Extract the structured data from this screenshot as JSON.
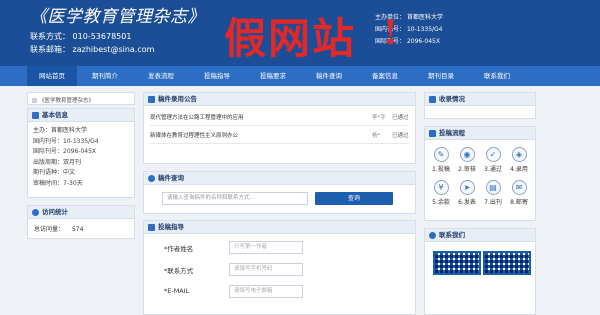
{
  "header": {
    "title": "《医学教育管理杂志》",
    "phone_label": "联系方式：",
    "phone": "010-53678501",
    "email_label": "联系邮箱：",
    "email": "zazhibest@sina.com",
    "sponsor_label": "主办单位：",
    "sponsor": "首都医科大学",
    "cn_label": "国内刊号：",
    "cn": "10-1335/G4",
    "issn_label": "国际刊号：",
    "issn": "2096-045X",
    "overlay_text": "假网站",
    "overlay_mark": "!"
  },
  "nav": [
    "网站首页",
    "期刊简介",
    "发表流程",
    "投稿指导",
    "投稿要求",
    "稿件查询",
    "备案信息",
    "期刊目录",
    "联系我们"
  ],
  "left": {
    "logo_alt": "《医学教育管理杂志》",
    "basic_title": "基本信息",
    "basic": [
      {
        "k": "主办：",
        "v": "首都医科大学"
      },
      {
        "k": "国内刊号：",
        "v": "10-1335/G4"
      },
      {
        "k": "国际刊号：",
        "v": "2096-045X"
      },
      {
        "k": "出版周期：",
        "v": "双月刊"
      },
      {
        "k": "期刊语种：",
        "v": "中文"
      },
      {
        "k": "审稿时间：",
        "v": "7-30天"
      }
    ],
    "stats_title": "访问统计",
    "visits_label": "总访问量：",
    "visits": "574"
  },
  "middle": {
    "notice_title": "稿件录用公告",
    "notices": [
      {
        "title": "现代管理方法在公路工程管理中的应用",
        "author": "李*字",
        "status": "已通过"
      },
      {
        "title": "新媒体在教育过程理性主义原则办公",
        "author": "杨*",
        "status": "已通过"
      }
    ],
    "query_title": "稿件查询",
    "query_placeholder": "请输入查询稿件的名称和联系方式...",
    "query_button": "查询",
    "guide_title": "投稿指导",
    "fields": [
      {
        "label": "*作者姓名",
        "placeholder": "只写第一作者"
      },
      {
        "label": "*联系方式",
        "placeholder": "请填写手机号码"
      },
      {
        "label": "*E-MAIL",
        "placeholder": "请填写电子邮箱"
      }
    ]
  },
  "right": {
    "collect_title": "收录情况",
    "flow_title": "投稿流程",
    "flow": [
      {
        "label": "1.投稿",
        "icon": "pencil-icon",
        "glyph": "✎"
      },
      {
        "label": "2.审核",
        "icon": "eye-icon",
        "glyph": "◉"
      },
      {
        "label": "3.通过",
        "icon": "check-icon",
        "glyph": "✓"
      },
      {
        "label": "4.录用",
        "icon": "layers-icon",
        "glyph": "◈"
      },
      {
        "label": "5.余款",
        "icon": "fee-icon",
        "glyph": "¥"
      },
      {
        "label": "6.发表",
        "icon": "send-icon",
        "glyph": "➤"
      },
      {
        "label": "7.出刊",
        "icon": "book-icon",
        "glyph": "▤"
      },
      {
        "label": "8.邮寄",
        "icon": "mail-icon",
        "glyph": "✉"
      }
    ],
    "contact_title": "联系我们"
  }
}
